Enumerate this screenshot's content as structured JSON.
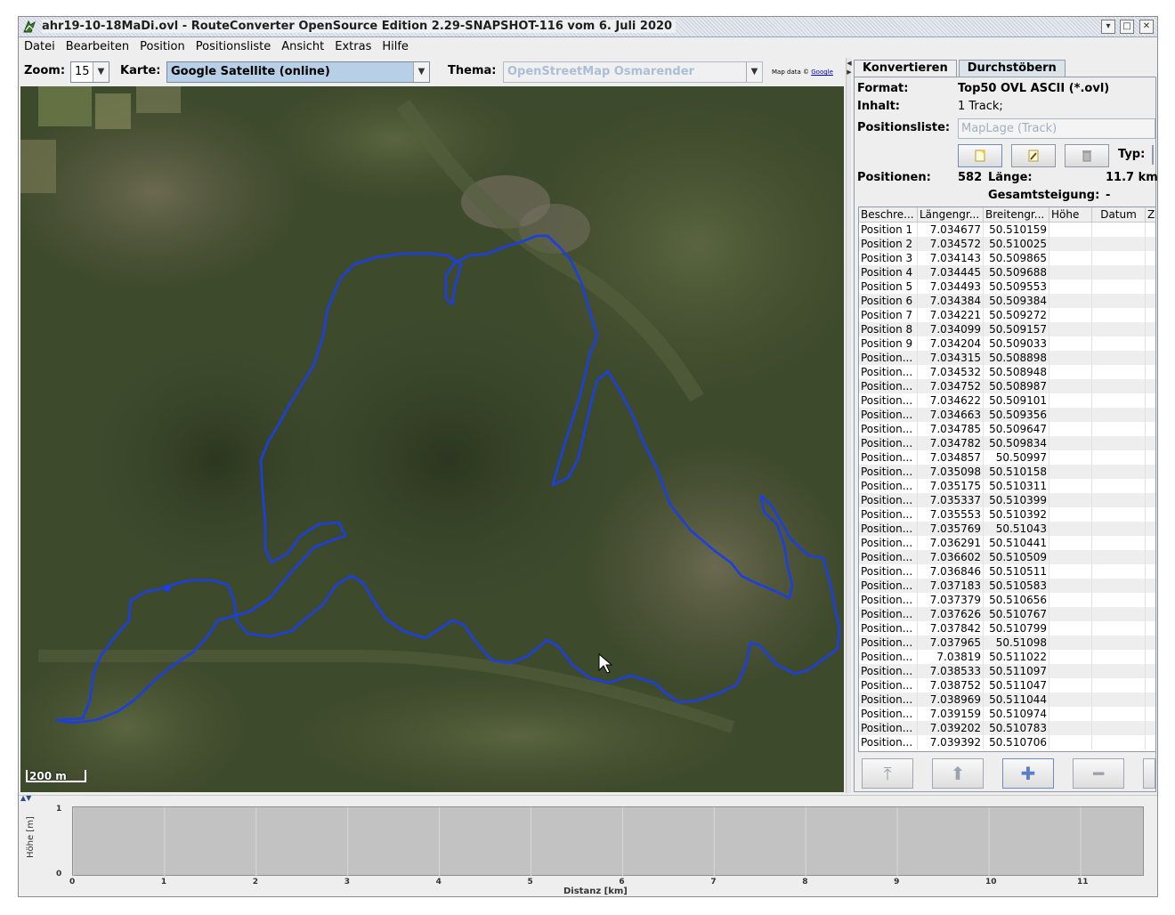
{
  "window": {
    "title": "ahr19-10-18MaDi.ovl - RouteConverter OpenSource Edition 2.29-SNAPSHOT-116 vom 6. Juli 2020"
  },
  "menu": [
    "Datei",
    "Bearbeiten",
    "Position",
    "Positionsliste",
    "Ansicht",
    "Extras",
    "Hilfe"
  ],
  "map_toolbar": {
    "zoom_label": "Zoom:",
    "zoom_value": "15",
    "karte_label": "Karte:",
    "karte_value": "Google Satellite (online)",
    "thema_label": "Thema:",
    "thema_value": "OpenStreetMap Osmarender",
    "attribution_prefix": "Map data ©",
    "attribution_link": "Google"
  },
  "map": {
    "scale_label": "200 m",
    "track_color": "#1b3fe0"
  },
  "tabs": [
    "Konvertieren",
    "Durchstöbern"
  ],
  "convert": {
    "format_label": "Format:",
    "format_value": "Top50 OVL ASCII (*.ovl)",
    "inhalt_label": "Inhalt:",
    "inhalt_value": "1 Track;",
    "positionsliste_label": "Positionsliste:",
    "positionsliste_value": "MapLage (Track)",
    "typ_label": "Typ:",
    "positionen_label": "Positionen:",
    "positionen_value": "582",
    "laenge_label": "Länge:",
    "laenge_value": "11.7 km",
    "steigung_label": "Gesamtsteigung:",
    "steigung_value": "-"
  },
  "table": {
    "columns": [
      "Beschre...",
      "Längengr...",
      "Breitengr...",
      "Höhe",
      "Datum",
      "Z"
    ],
    "rows": [
      [
        "Position 1",
        "7.034677",
        "50.510159"
      ],
      [
        "Position 2",
        "7.034572",
        "50.510025"
      ],
      [
        "Position 3",
        "7.034143",
        "50.509865"
      ],
      [
        "Position 4",
        "7.034445",
        "50.509688"
      ],
      [
        "Position 5",
        "7.034493",
        "50.509553"
      ],
      [
        "Position 6",
        "7.034384",
        "50.509384"
      ],
      [
        "Position 7",
        "7.034221",
        "50.509272"
      ],
      [
        "Position 8",
        "7.034099",
        "50.509157"
      ],
      [
        "Position 9",
        "7.034204",
        "50.509033"
      ],
      [
        "Position...",
        "7.034315",
        "50.508898"
      ],
      [
        "Position...",
        "7.034532",
        "50.508948"
      ],
      [
        "Position...",
        "7.034752",
        "50.508987"
      ],
      [
        "Position...",
        "7.034622",
        "50.509101"
      ],
      [
        "Position...",
        "7.034663",
        "50.509356"
      ],
      [
        "Position...",
        "7.034785",
        "50.509647"
      ],
      [
        "Position...",
        "7.034782",
        "50.509834"
      ],
      [
        "Position...",
        "7.034857",
        "50.50997"
      ],
      [
        "Position...",
        "7.035098",
        "50.510158"
      ],
      [
        "Position...",
        "7.035175",
        "50.510311"
      ],
      [
        "Position...",
        "7.035337",
        "50.510399"
      ],
      [
        "Position...",
        "7.035553",
        "50.510392"
      ],
      [
        "Position...",
        "7.035769",
        "50.51043"
      ],
      [
        "Position...",
        "7.036291",
        "50.510441"
      ],
      [
        "Position...",
        "7.036602",
        "50.510509"
      ],
      [
        "Position...",
        "7.036846",
        "50.510511"
      ],
      [
        "Position...",
        "7.037183",
        "50.510583"
      ],
      [
        "Position...",
        "7.037379",
        "50.510656"
      ],
      [
        "Position...",
        "7.037626",
        "50.510767"
      ],
      [
        "Position...",
        "7.037842",
        "50.510799"
      ],
      [
        "Position...",
        "7.037965",
        "50.51098"
      ],
      [
        "Position...",
        "7.03819",
        "50.511022"
      ],
      [
        "Position...",
        "7.038533",
        "50.511097"
      ],
      [
        "Position...",
        "7.038752",
        "50.511047"
      ],
      [
        "Position...",
        "7.038969",
        "50.511044"
      ],
      [
        "Position...",
        "7.039159",
        "50.510974"
      ],
      [
        "Position...",
        "7.039202",
        "50.510783"
      ],
      [
        "Position...",
        "7.039392",
        "50.510706"
      ]
    ]
  },
  "bottom_buttons": [
    {
      "icon": "move-to-top-icon",
      "symbol": "⤒"
    },
    {
      "icon": "move-up-icon",
      "symbol": "⬆"
    },
    {
      "icon": "add-icon",
      "symbol": "✚"
    },
    {
      "icon": "remove-icon",
      "symbol": "━"
    }
  ],
  "profile": {
    "y_label": "Höhe [m]",
    "x_label": "Distanz [km]",
    "y_ticks": [
      "1",
      "0"
    ],
    "x_ticks": [
      "0",
      "1",
      "2",
      "3",
      "4",
      "5",
      "6",
      "7",
      "8",
      "9",
      "10",
      "11"
    ]
  }
}
